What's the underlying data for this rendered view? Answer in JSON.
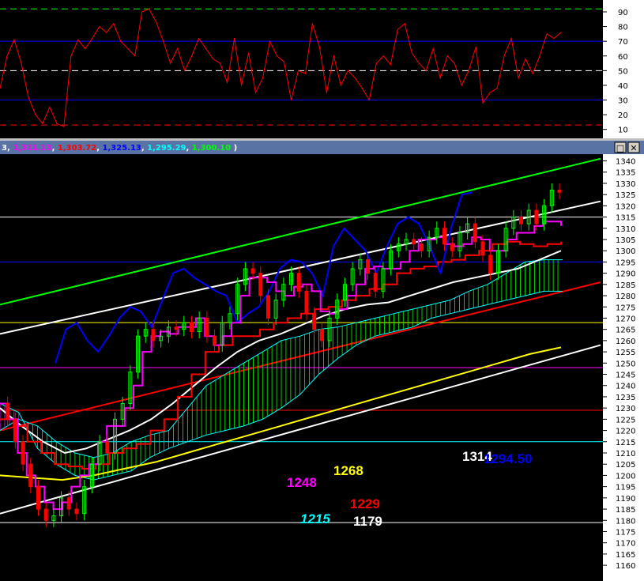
{
  "window": {
    "legend_values": [
      {
        "text": "3",
        "color": "#ffffff"
      },
      {
        "text": ", ",
        "color": "#ffffff"
      },
      {
        "text": "1,311.13",
        "color": "#ff00ff"
      },
      {
        "text": ", ",
        "color": "#ffffff"
      },
      {
        "text": "1,303.72",
        "color": "#ff0000"
      },
      {
        "text": ", ",
        "color": "#ffffff"
      },
      {
        "text": "1,325.13",
        "color": "#0000ff"
      },
      {
        "text": ", ",
        "color": "#ffffff"
      },
      {
        "text": "1,295.29",
        "color": "#00ffff"
      },
      {
        "text": ", ",
        "color": "#ffffff"
      },
      {
        "text": "1,300.10",
        "color": "#00ff00"
      },
      {
        "text": " )",
        "color": "#ffffff"
      }
    ],
    "restore_glyph": "□",
    "close_glyph": "✕"
  },
  "colors": {
    "background": "#000000",
    "axis_bg": "#ffffff",
    "titlebar": "#5a73a5",
    "candle_up": "#00ff00",
    "candle_down": "#ff0000",
    "oscillator": "#ff0000",
    "tenkan": "#ff00ff",
    "kijun": "#ff0000",
    "chikou": "#0000ff",
    "sma": "#ffffff",
    "long_ma": "#ffff00",
    "cloud_fill": "#00ff00"
  },
  "chart_data": [
    {
      "type": "line",
      "series": [
        {
          "values": [
            38,
            60,
            71,
            55,
            32,
            20,
            14,
            25,
            14,
            12,
            60,
            71,
            65,
            72,
            80,
            76,
            82,
            70,
            65,
            60,
            90,
            92,
            83,
            70,
            55,
            65,
            50,
            60,
            72,
            65,
            58,
            55,
            42,
            72,
            40,
            62,
            35,
            45,
            70,
            60,
            56,
            30,
            50,
            48,
            82,
            66,
            35,
            60,
            40,
            50,
            45,
            38,
            30,
            55,
            60,
            54,
            78,
            82,
            62,
            55,
            50,
            65,
            45,
            60,
            55,
            40,
            50,
            66,
            28,
            35,
            38,
            60,
            72,
            45,
            58,
            48,
            60,
            75,
            72,
            76
          ]
        }
      ],
      "yticks": [
        10,
        20,
        30,
        40,
        50,
        60,
        70,
        80,
        90
      ],
      "ylim": [
        5,
        97
      ],
      "hlines": [
        {
          "value": 92,
          "color": "#00ff00",
          "style": "dash"
        },
        {
          "value": 70,
          "color": "#0000ff",
          "style": "solid"
        },
        {
          "value": 50,
          "color": "#ffffff",
          "style": "dash"
        },
        {
          "value": 30,
          "color": "#0000ff",
          "style": "solid"
        },
        {
          "value": 13,
          "color": "#ff0000",
          "style": "dash"
        }
      ]
    },
    {
      "type": "line",
      "ylim": [
        1153,
        1343
      ],
      "yticks": [
        1160,
        1165,
        1170,
        1175,
        1180,
        1185,
        1190,
        1195,
        1200,
        1205,
        1210,
        1215,
        1220,
        1225,
        1230,
        1235,
        1240,
        1245,
        1250,
        1255,
        1260,
        1265,
        1270,
        1275,
        1280,
        1285,
        1290,
        1295,
        1300,
        1305,
        1310,
        1315,
        1320,
        1325,
        1330,
        1335,
        1340
      ],
      "hlines": [
        {
          "value": 1315,
          "color": "#ffffff"
        },
        {
          "value": 1295,
          "color": "#0000ff"
        },
        {
          "value": 1268,
          "color": "#ffff00"
        },
        {
          "value": 1248,
          "color": "#ff00ff"
        },
        {
          "value": 1229,
          "color": "#ff0000"
        },
        {
          "value": 1215,
          "color": "#00ffff"
        },
        {
          "value": 1179,
          "color": "#ffffff"
        }
      ],
      "price": [
        1232,
        1225,
        1215,
        1205,
        1195,
        1185,
        1180,
        1182,
        1190,
        1185,
        1183,
        1195,
        1205,
        1215,
        1210,
        1225,
        1232,
        1246,
        1262,
        1265,
        1260,
        1262,
        1266,
        1265,
        1268,
        1264,
        1270,
        1262,
        1258,
        1268,
        1272,
        1285,
        1292,
        1290,
        1280,
        1270,
        1278,
        1285,
        1290,
        1282,
        1272,
        1265,
        1260,
        1270,
        1278,
        1285,
        1292,
        1296,
        1290,
        1282,
        1292,
        1300,
        1303,
        1305,
        1303,
        1300,
        1306,
        1310,
        1303,
        1300,
        1308,
        1312,
        1304,
        1298,
        1290,
        1300,
        1310,
        1315,
        1312,
        1318,
        1312,
        1320,
        1327,
        1326
      ],
      "tenkan": [
        1232,
        1225,
        1210,
        1200,
        1195,
        1188,
        1185,
        1188,
        1195,
        1200,
        1205,
        1215,
        1222,
        1222,
        1230,
        1240,
        1255,
        1262,
        1264,
        1263,
        1266,
        1266,
        1270,
        1262,
        1258,
        1262,
        1268,
        1280,
        1288,
        1288,
        1286,
        1282,
        1280,
        1284,
        1285,
        1282,
        1273,
        1272,
        1274,
        1280,
        1285,
        1292,
        1293,
        1292,
        1292,
        1295,
        1300,
        1305,
        1305,
        1306,
        1303,
        1302,
        1303,
        1306,
        1305,
        1300,
        1300,
        1305,
        1308,
        1308,
        1311,
        1313,
        1313,
        1311
      ],
      "kijun": [
        1225,
        1222,
        1215,
        1210,
        1205,
        1204,
        1203,
        1205,
        1210,
        1212,
        1214,
        1220,
        1225,
        1235,
        1245,
        1255,
        1258,
        1262,
        1262,
        1265,
        1268,
        1270,
        1272,
        1274,
        1275,
        1278,
        1280,
        1283,
        1285,
        1290,
        1292,
        1293,
        1295,
        1296,
        1298,
        1300,
        1303,
        1304,
        1303,
        1302,
        1303,
        1304
      ],
      "sma": [
        1230,
        1222,
        1215,
        1210,
        1212,
        1216,
        1220,
        1225,
        1232,
        1240,
        1248,
        1255,
        1260,
        1263,
        1267,
        1271,
        1274,
        1276,
        1277,
        1280,
        1283,
        1286,
        1288,
        1290,
        1292,
        1296,
        1300
      ],
      "long_ma": [
        1200,
        1199,
        1198,
        1200,
        1203,
        1206,
        1210,
        1214,
        1218,
        1222,
        1226,
        1230,
        1234,
        1238,
        1242,
        1246,
        1250,
        1254,
        1257
      ],
      "chikou": [
        1250,
        1265,
        1268,
        1260,
        1255,
        1262,
        1270,
        1275,
        1273,
        1266,
        1278,
        1290,
        1292,
        1288,
        1285,
        1282,
        1280,
        1268,
        1272,
        1275,
        1282,
        1292,
        1296,
        1295,
        1290,
        1280,
        1302,
        1310,
        1305,
        1300,
        1290,
        1302,
        1312,
        1315,
        1312,
        1302,
        1290,
        1310,
        1325,
        1326
      ],
      "cloud_span_a": [
        1220,
        1225,
        1222,
        1215,
        1210,
        1208,
        1210,
        1215,
        1218,
        1220,
        1230,
        1240,
        1245,
        1250,
        1255,
        1260,
        1262,
        1265,
        1266,
        1268,
        1270,
        1272,
        1274,
        1276,
        1278,
        1282,
        1285,
        1290,
        1295,
        1296,
        1296
      ],
      "cloud_span_b": [
        1232,
        1228,
        1212,
        1205,
        1200,
        1198,
        1200,
        1202,
        1208,
        1212,
        1215,
        1218,
        1220,
        1222,
        1225,
        1230,
        1236,
        1245,
        1252,
        1258,
        1262,
        1264,
        1266,
        1270,
        1272,
        1274,
        1276,
        1278,
        1280,
        1282,
        1282
      ],
      "trendlines": [
        {
          "color": "#00ff00",
          "from": [
            1276,
            0
          ],
          "to": [
            1341,
            1
          ]
        },
        {
          "color": "#ffffff",
          "from": [
            1263,
            0
          ],
          "to": [
            1322,
            1
          ]
        },
        {
          "color": "#ffffff",
          "from": [
            1183,
            0
          ],
          "to": [
            1258,
            1
          ]
        },
        {
          "color": "#ff0000",
          "from": [
            1220,
            0
          ],
          "to": [
            1286,
            1
          ]
        }
      ],
      "annotations": [
        {
          "text": "1314",
          "color": "#ffffff",
          "italic": false
        },
        {
          "text": "1294.50",
          "color": "#0000ff",
          "italic": false
        },
        {
          "text": "1268",
          "color": "#ffff00",
          "italic": false
        },
        {
          "text": "1248",
          "color": "#ff00ff",
          "italic": false
        },
        {
          "text": "1229",
          "color": "#ff0000",
          "italic": false
        },
        {
          "text": "1215",
          "color": "#00ffff",
          "italic": true
        },
        {
          "text": "1179",
          "color": "#ffffff",
          "italic": false
        }
      ]
    }
  ]
}
